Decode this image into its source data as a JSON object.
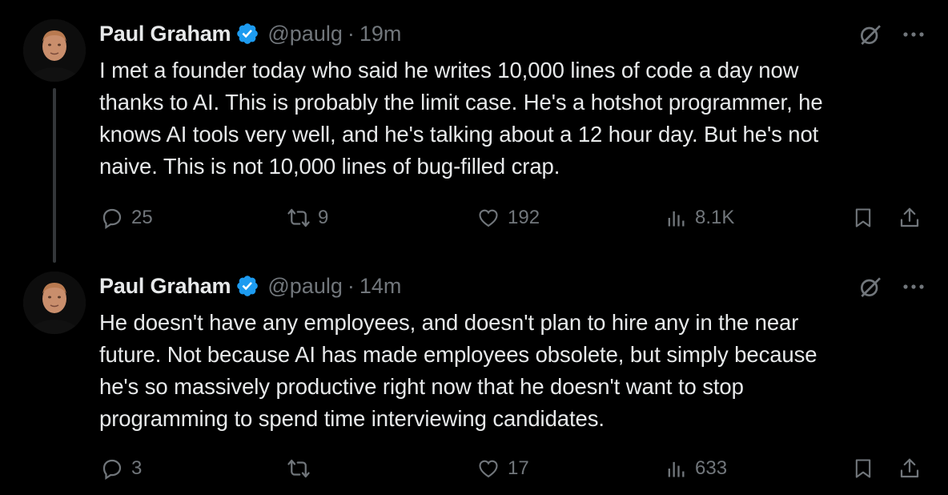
{
  "colors": {
    "background": "#000000",
    "text_primary": "#e7e9ea",
    "text_secondary": "#71767b",
    "verified_badge": "#1d9bf0",
    "thread_line": "#333639"
  },
  "tweets": [
    {
      "author": {
        "name": "Paul Graham",
        "handle": "@paulg",
        "verified_icon": "verified-badge-icon"
      },
      "separator": "·",
      "time": "19m",
      "text": "I met a founder today who said he writes 10,000 lines of code a day now\nthanks to AI. This is probably the limit case. He's a hotshot programmer, he\nknows AI tools very well, and he's talking about a 12 hour day. But he's not\nnaive. This is not 10,000 lines of bug-filled crap.",
      "stats": {
        "replies": "25",
        "reposts": "9",
        "likes": "192",
        "views": "8.1K"
      }
    },
    {
      "author": {
        "name": "Paul Graham",
        "handle": "@paulg",
        "verified_icon": "verified-badge-icon"
      },
      "separator": "·",
      "time": "14m",
      "text": "He doesn't have any employees, and doesn't plan to hire any in the near\nfuture. Not because AI has made employees obsolete, but simply because\nhe's so massively productive right now that he doesn't want to stop\nprogramming to spend time interviewing candidates.",
      "stats": {
        "replies": "3",
        "reposts": "",
        "likes": "17",
        "views": "633"
      }
    }
  ],
  "icons": {
    "grok": "grok-icon",
    "more": "more-icon",
    "reply": "reply-icon",
    "repost": "repost-icon",
    "like": "heart-icon",
    "views": "views-icon",
    "bookmark": "bookmark-icon",
    "share": "share-icon"
  }
}
